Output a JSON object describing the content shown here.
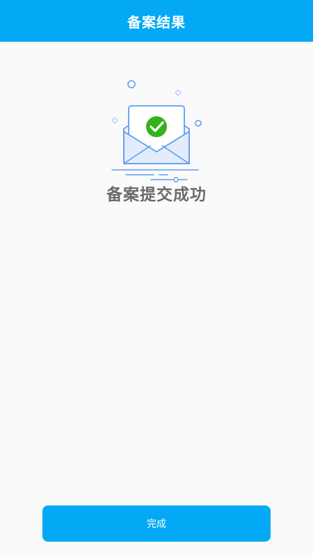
{
  "header": {
    "title": "备案结果"
  },
  "result": {
    "message": "备案提交成功",
    "icon": "envelope-check-icon",
    "success_color": "#34b21a",
    "outline_color": "#5b9ef0"
  },
  "footer": {
    "done_label": "完成"
  },
  "colors": {
    "accent": "#03a9f4",
    "background": "#fafafa",
    "text": "#6b6b6b"
  }
}
